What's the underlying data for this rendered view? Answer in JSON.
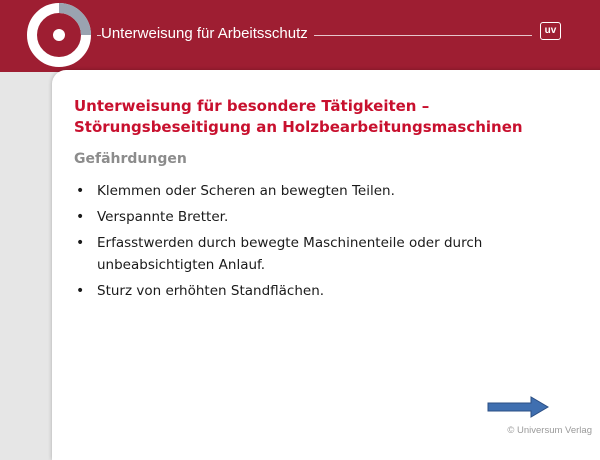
{
  "header": {
    "title": "Unterweisung für Arbeitsschutz",
    "badge": "uv"
  },
  "slide": {
    "title": "Unterweisung für besondere Tätigkeiten – Störungsbeseitigung an Holzbearbeitungsmaschinen",
    "subheading": "Gefährdungen",
    "bullets": [
      "Klemmen oder Scheren an bewegten Teilen.",
      "Verspannte Bretter.",
      "Erfasstwerden durch bewegte Maschinenteile oder durch unbeabsichtigten Anlauf.",
      "Sturz von erhöhten Standflächen."
    ]
  },
  "footer": {
    "copyright": "© Universum Verlag",
    "next_icon": "arrow-right-icon"
  },
  "colors": {
    "header_bg": "#9e1e32",
    "title_red": "#c8102e",
    "subhead_gray": "#8c8c8c",
    "arrow_blue": "#3f6fb0"
  }
}
